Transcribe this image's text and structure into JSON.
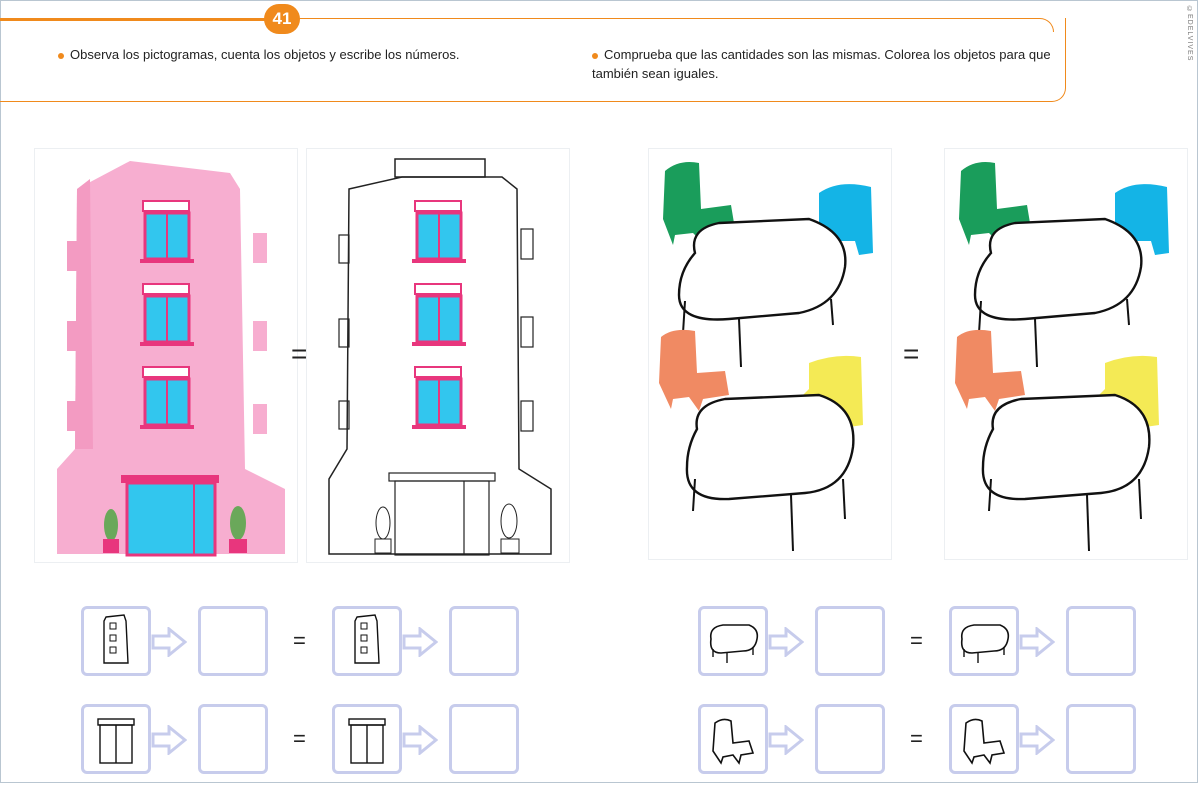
{
  "page_number": "41",
  "publisher_mark": "©EDELVIVES",
  "instructions": {
    "left": "Observa los pictogramas, cuenta los objetos y escribe los números.",
    "right": "Comprueba que las cantidades son las mismas. Colorea los objetos para que también sean iguales."
  },
  "equals_sign": "=",
  "colors": {
    "accent": "#f08a1c",
    "box_border": "#c7ccec",
    "pink": "#f7aed0",
    "window_blue": "#32c6ee",
    "green": "#1a9d5b",
    "cyan": "#14b4e6",
    "salmon": "#f08a63",
    "yellow": "#f4ea55"
  },
  "exercise_rows": [
    {
      "icon_left": "window-icon",
      "icon_right": "window-icon"
    },
    {
      "icon_left": "door-icon",
      "icon_right": "door-icon"
    },
    {
      "icon_left": "table-icon",
      "icon_right": "table-icon"
    },
    {
      "icon_left": "chair-icon",
      "icon_right": "chair-icon"
    }
  ]
}
